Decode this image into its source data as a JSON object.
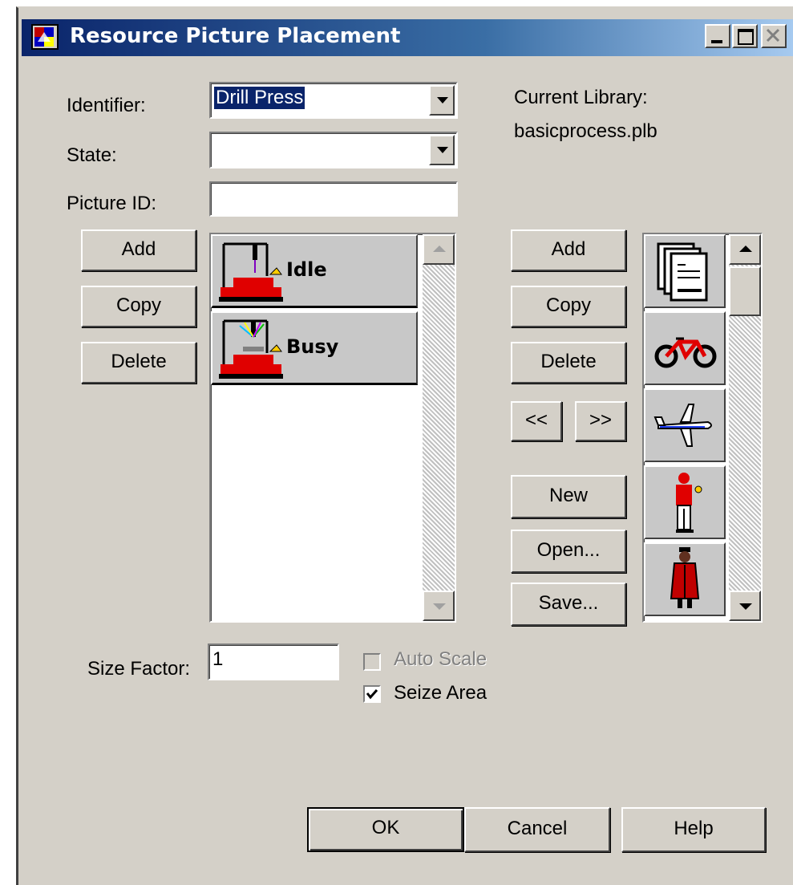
{
  "window": {
    "title": "Resource Picture Placement",
    "controls": [
      "minimize",
      "maximize",
      "close"
    ]
  },
  "form": {
    "identifier_label": "Identifier:",
    "identifier_value": "Drill Press",
    "state_label": "State:",
    "state_value": "",
    "picture_id_label": "Picture ID:",
    "picture_id_value": "",
    "current_library_label": "Current Library:",
    "current_library_value": "basicprocess.plb"
  },
  "left_buttons": {
    "add": "Add",
    "copy": "Copy",
    "delete": "Delete"
  },
  "states": [
    {
      "name": "Idle",
      "icon": "drill-press-idle-icon"
    },
    {
      "name": "Busy",
      "icon": "drill-press-busy-icon"
    }
  ],
  "right_buttons": {
    "add": "Add",
    "copy": "Copy",
    "delete": "Delete",
    "prev": "<<",
    "next": ">>",
    "new": "New",
    "open": "Open...",
    "save": "Save..."
  },
  "library_pictures": [
    {
      "icon": "documents-icon"
    },
    {
      "icon": "bicycle-icon"
    },
    {
      "icon": "airplane-icon"
    },
    {
      "icon": "person-icon"
    },
    {
      "icon": "person-coat-icon"
    }
  ],
  "options": {
    "size_factor_label": "Size Factor:",
    "size_factor_value": "1",
    "auto_scale_label": "Auto Scale",
    "auto_scale_checked": false,
    "auto_scale_enabled": false,
    "seize_area_label": "Seize Area",
    "seize_area_checked": true
  },
  "footer": {
    "ok": "OK",
    "cancel": "Cancel",
    "help": "Help"
  },
  "colors": {
    "dialog_bg": "#d4d0c8",
    "titlebar_start": "#0a246a",
    "titlebar_end": "#a6caf0",
    "selection": "#0a246a",
    "machine_red": "#e00000"
  }
}
